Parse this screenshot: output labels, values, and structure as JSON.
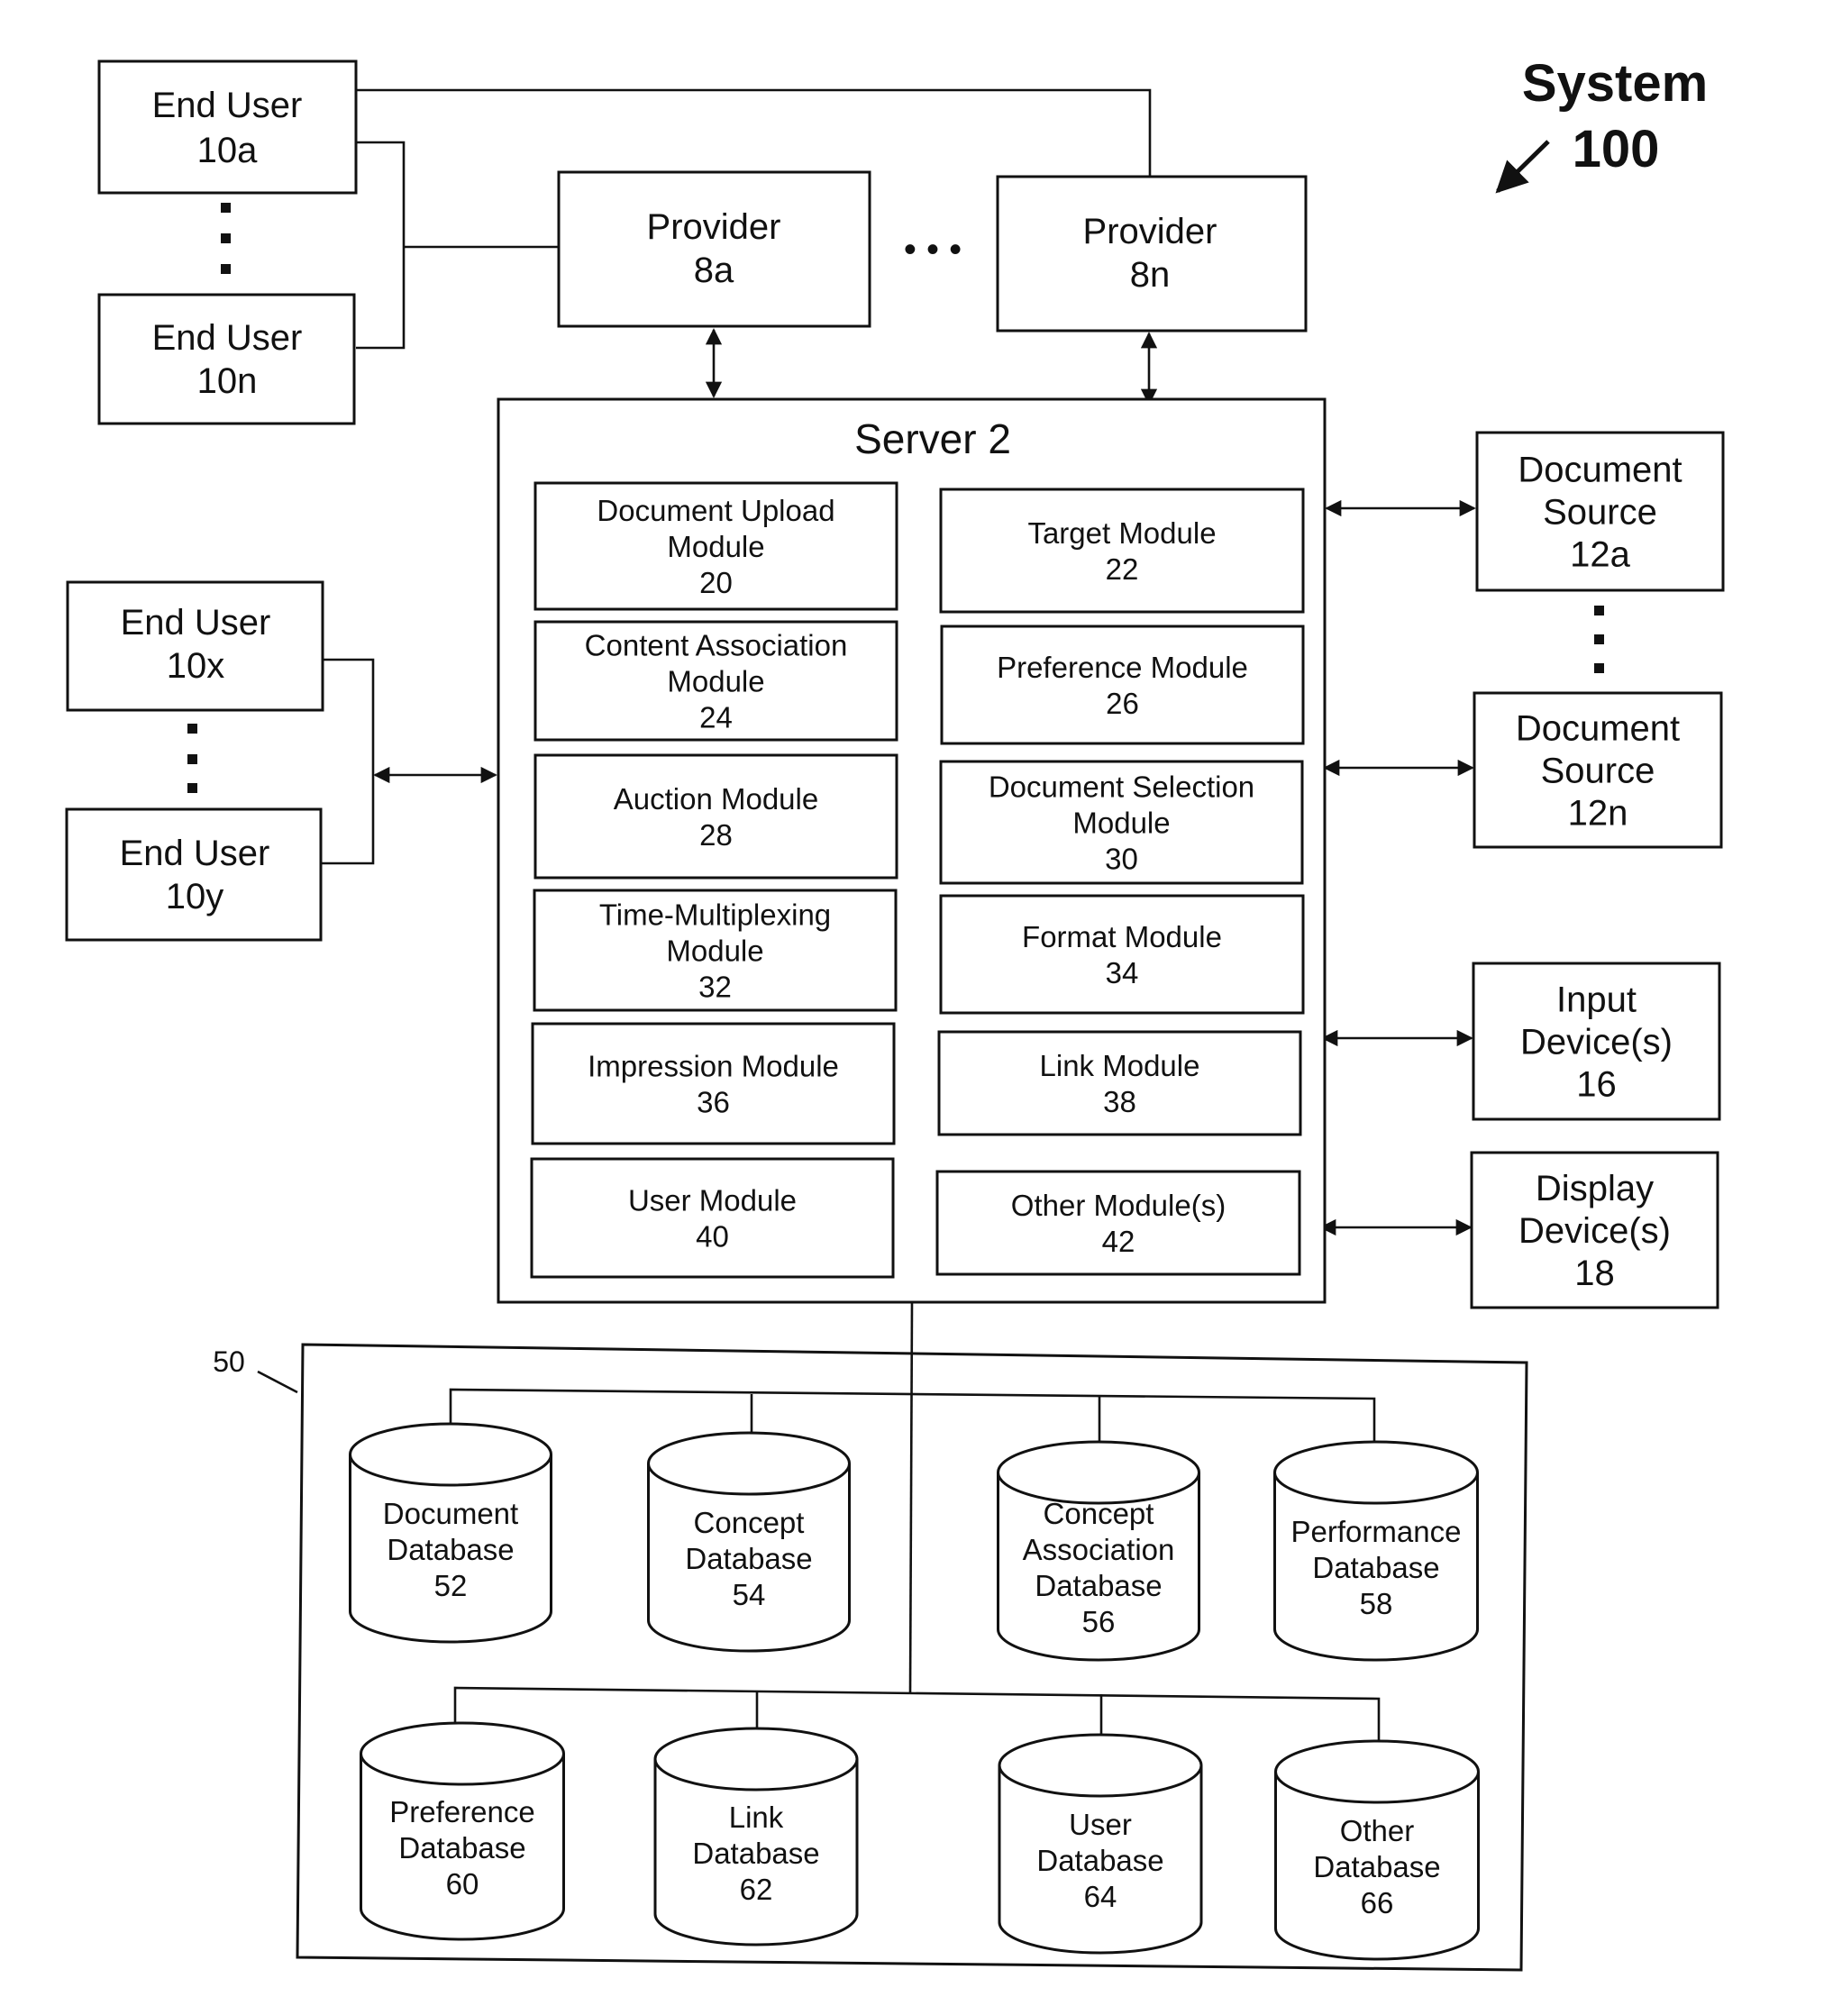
{
  "system": {
    "label": "System",
    "number": "100"
  },
  "end_users_top": [
    {
      "label": "End User",
      "id": "10a"
    },
    {
      "label": "End User",
      "id": "10n"
    }
  ],
  "providers": [
    {
      "label": "Provider",
      "id": "8a"
    },
    {
      "label": "Provider",
      "id": "8n"
    }
  ],
  "server": {
    "title": "Server 2",
    "modules": [
      {
        "lines": [
          "Document Upload",
          "Module"
        ],
        "id": "20"
      },
      {
        "lines": [
          "Target Module"
        ],
        "id": "22"
      },
      {
        "lines": [
          "Content Association",
          "Module"
        ],
        "id": "24"
      },
      {
        "lines": [
          "Preference Module"
        ],
        "id": "26"
      },
      {
        "lines": [
          "Auction Module"
        ],
        "id": "28"
      },
      {
        "lines": [
          "Document Selection",
          "Module"
        ],
        "id": "30"
      },
      {
        "lines": [
          "Time-Multiplexing",
          "Module"
        ],
        "id": "32"
      },
      {
        "lines": [
          "Format Module"
        ],
        "id": "34"
      },
      {
        "lines": [
          "Impression Module"
        ],
        "id": "36"
      },
      {
        "lines": [
          "Link Module"
        ],
        "id": "38"
      },
      {
        "lines": [
          "User Module"
        ],
        "id": "40"
      },
      {
        "lines": [
          "Other Module(s)"
        ],
        "id": "42"
      }
    ]
  },
  "end_users_left": [
    {
      "label": "End User",
      "id": "10x"
    },
    {
      "label": "End User",
      "id": "10y"
    }
  ],
  "right_devices": [
    {
      "lines": [
        "Document",
        "Source"
      ],
      "id": "12a"
    },
    {
      "lines": [
        "Document",
        "Source"
      ],
      "id": "12n"
    },
    {
      "lines": [
        "Input",
        "Device(s)"
      ],
      "id": "16"
    },
    {
      "lines": [
        "Display",
        "Device(s)"
      ],
      "id": "18"
    }
  ],
  "database_group": {
    "ref": "50",
    "databases": [
      {
        "lines": [
          "Document",
          "Database"
        ],
        "id": "52"
      },
      {
        "lines": [
          "Concept",
          "Database"
        ],
        "id": "54"
      },
      {
        "lines": [
          "Concept",
          "Association",
          "Database"
        ],
        "id": "56"
      },
      {
        "lines": [
          "Performance",
          "Database"
        ],
        "id": "58"
      },
      {
        "lines": [
          "Preference",
          "Database"
        ],
        "id": "60"
      },
      {
        "lines": [
          "Link",
          "Database"
        ],
        "id": "62"
      },
      {
        "lines": [
          "User",
          "Database"
        ],
        "id": "64"
      },
      {
        "lines": [
          "Other",
          "Database"
        ],
        "id": "66"
      }
    ]
  },
  "ellipsis": "• • •"
}
